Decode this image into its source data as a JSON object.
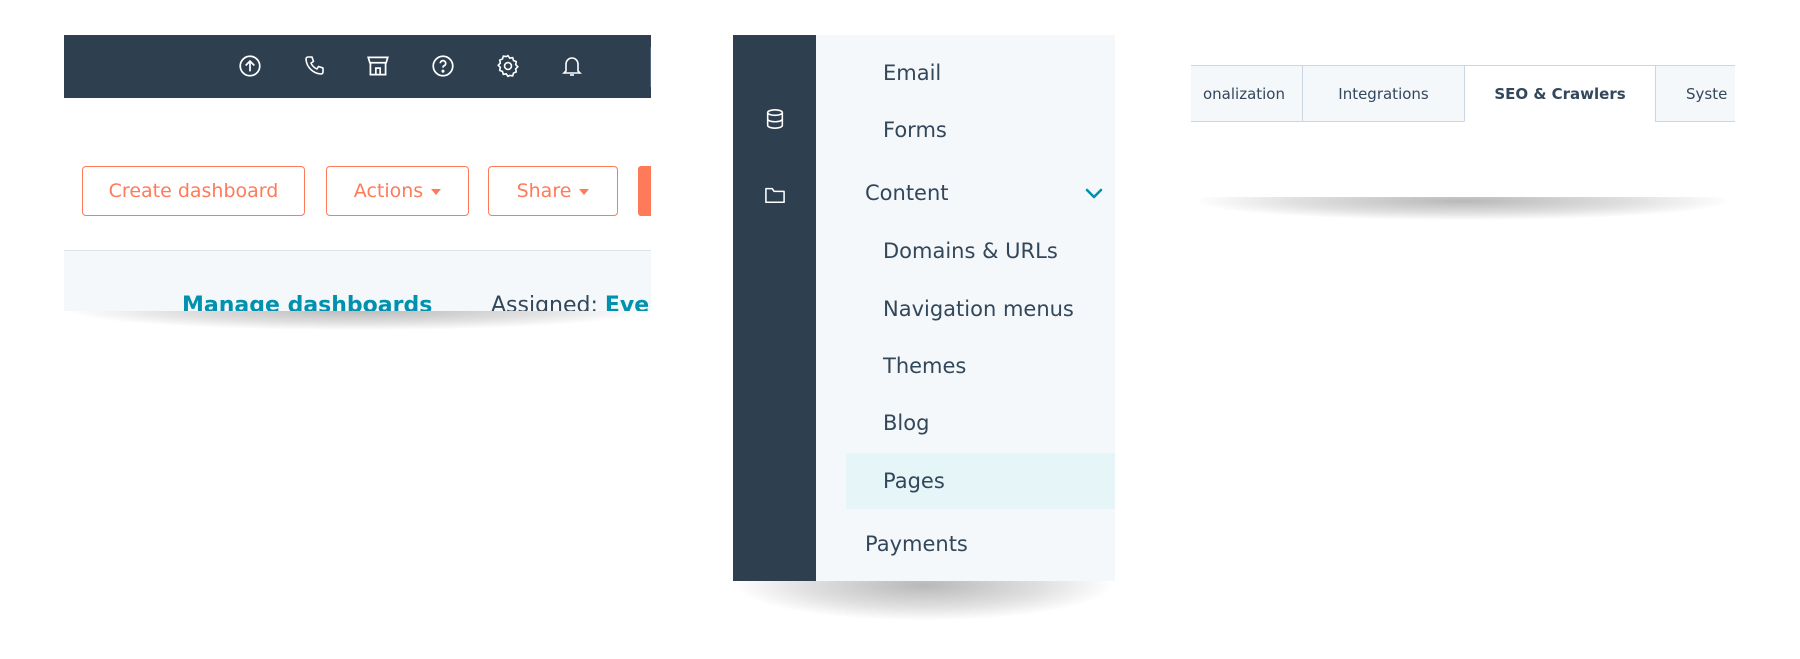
{
  "panel_header": {
    "icons": [
      "upgrade-icon",
      "calling-icon",
      "marketplace-icon",
      "help-icon",
      "settings-icon",
      "notifications-icon"
    ]
  },
  "dashboard_actions": {
    "create_dashboard_label": "Create dashboard",
    "actions_label": "Actions",
    "share_label": "Share"
  },
  "dashboard_filters": {
    "manage_dashboards_label": "Manage dashboards",
    "assigned_label": "Assigned:",
    "assigned_value": "Eve"
  },
  "settings_rail": {
    "icons": [
      "database-icon",
      "folder-icon"
    ]
  },
  "settings_nav": {
    "items": [
      {
        "label": "Email"
      },
      {
        "label": "Forms"
      },
      {
        "label": "Content"
      },
      {
        "label": "Domains & URLs"
      },
      {
        "label": "Navigation menus"
      },
      {
        "label": "Themes"
      },
      {
        "label": "Blog"
      },
      {
        "label": "Pages"
      },
      {
        "label": "Payments"
      }
    ]
  },
  "settings_tabs": {
    "tabs": [
      {
        "label": "onalization"
      },
      {
        "label": "Integrations"
      },
      {
        "label": "SEO & Crawlers"
      },
      {
        "label": "Syste"
      }
    ],
    "active_tab": "SEO & Crawlers"
  },
  "colors": {
    "nav_dark": "#2e3f50",
    "accent_orange": "#ff7a59",
    "link_teal": "#0091ae",
    "text_dark": "#33475b",
    "active_bg": "#e5f5f8",
    "page_bg": "#f5f8fa"
  }
}
